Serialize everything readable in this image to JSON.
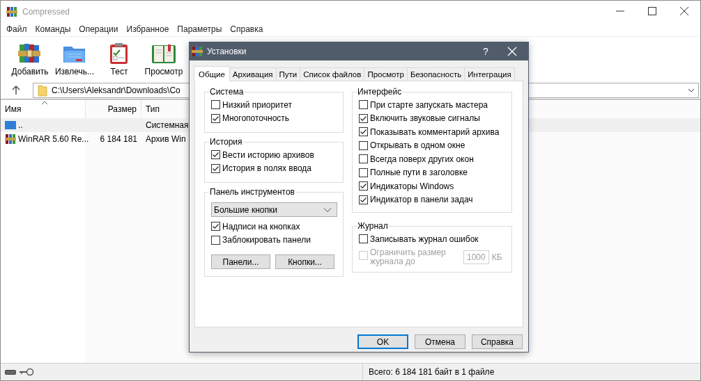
{
  "window": {
    "title": "Compressed"
  },
  "menu": [
    "Файл",
    "Команды",
    "Операции",
    "Избранное",
    "Параметры",
    "Справка"
  ],
  "toolbar": [
    {
      "kind": "add",
      "label": "Добавить"
    },
    {
      "kind": "extract",
      "label": "Извлечь..."
    },
    {
      "kind": "test",
      "label": "Тест"
    },
    {
      "kind": "view",
      "label": "Просмотр"
    }
  ],
  "address": {
    "path": "C:\\Users\\Aleksandr\\Downloads\\Co"
  },
  "file_list": {
    "columns": [
      "Имя",
      "Размер",
      "Тип"
    ],
    "rows": [
      {
        "kind": "folder",
        "name": "..",
        "type": "Системная",
        "selected": true
      },
      {
        "kind": "archive",
        "name": "WinRAR 5.60 Re...",
        "size": "6 184 181",
        "type": "Архив Win",
        "selected": false
      }
    ]
  },
  "status_bar": {
    "text": "Всего: 6 184 181 байт в 1 файле"
  },
  "dialog": {
    "title": "Установки",
    "help": "?",
    "tabs": [
      {
        "label": "Общие",
        "selected": true
      },
      {
        "label": "Архивация",
        "selected": false
      },
      {
        "label": "Пути",
        "selected": false
      },
      {
        "label": "Список файлов",
        "selected": false
      },
      {
        "label": "Просмотр",
        "selected": false
      },
      {
        "label": "Безопасность",
        "selected": false
      },
      {
        "label": "Интеграция",
        "selected": false
      }
    ],
    "columns": [
      {
        "groups": [
          {
            "title": "Система",
            "items": [
              {
                "kind": "checkbox",
                "label": "Низкий приоритет",
                "checked": false
              },
              {
                "kind": "checkbox",
                "label": "Многопоточность",
                "checked": true
              }
            ]
          },
          {
            "title": "История",
            "items": [
              {
                "kind": "checkbox",
                "label": "Вести историю архивов",
                "checked": true
              },
              {
                "kind": "checkbox",
                "label": "История в полях ввода",
                "checked": true
              }
            ]
          },
          {
            "title": "Панель инструментов",
            "items": [
              {
                "kind": "dropdown",
                "value": "Большие кнопки"
              },
              {
                "kind": "checkbox",
                "label": "Надписи на кнопках",
                "checked": true
              },
              {
                "kind": "checkbox",
                "label": "Заблокировать панели",
                "checked": false
              },
              {
                "kind": "buttons",
                "labels": [
                  "Панели...",
                  "Кнопки..."
                ]
              }
            ]
          }
        ]
      },
      {
        "groups": [
          {
            "title": "Интерфейс",
            "items": [
              {
                "kind": "checkbox",
                "label": "При старте запускать мастера",
                "checked": false
              },
              {
                "kind": "checkbox",
                "label": "Включить звуковые сигналы",
                "checked": true
              },
              {
                "kind": "checkbox",
                "label": "Показывать комментарий архива",
                "checked": true
              },
              {
                "kind": "checkbox",
                "label": "Открывать в одном окне",
                "checked": false
              },
              {
                "kind": "checkbox",
                "label": "Всегда поверх других окон",
                "checked": false
              },
              {
                "kind": "checkbox",
                "label": "Полные пути в заголовке",
                "checked": false
              },
              {
                "kind": "checkbox",
                "label": "Индикаторы Windows",
                "checked": true
              },
              {
                "kind": "checkbox",
                "label": "Индикатор в панели задач",
                "checked": true
              }
            ]
          },
          {
            "title": "Журнал",
            "items": [
              {
                "kind": "checkbox",
                "label": "Записывать журнал ошибок",
                "checked": false
              },
              {
                "kind": "limit",
                "label": "Ограничить размер журнала до",
                "checked": false,
                "disabled": true,
                "value": "1000",
                "unit": "КБ"
              }
            ]
          }
        ]
      }
    ],
    "buttons": [
      {
        "label": "OK",
        "default": true
      },
      {
        "label": "Отмена",
        "default": false
      },
      {
        "label": "Справка",
        "default": false
      }
    ]
  }
}
